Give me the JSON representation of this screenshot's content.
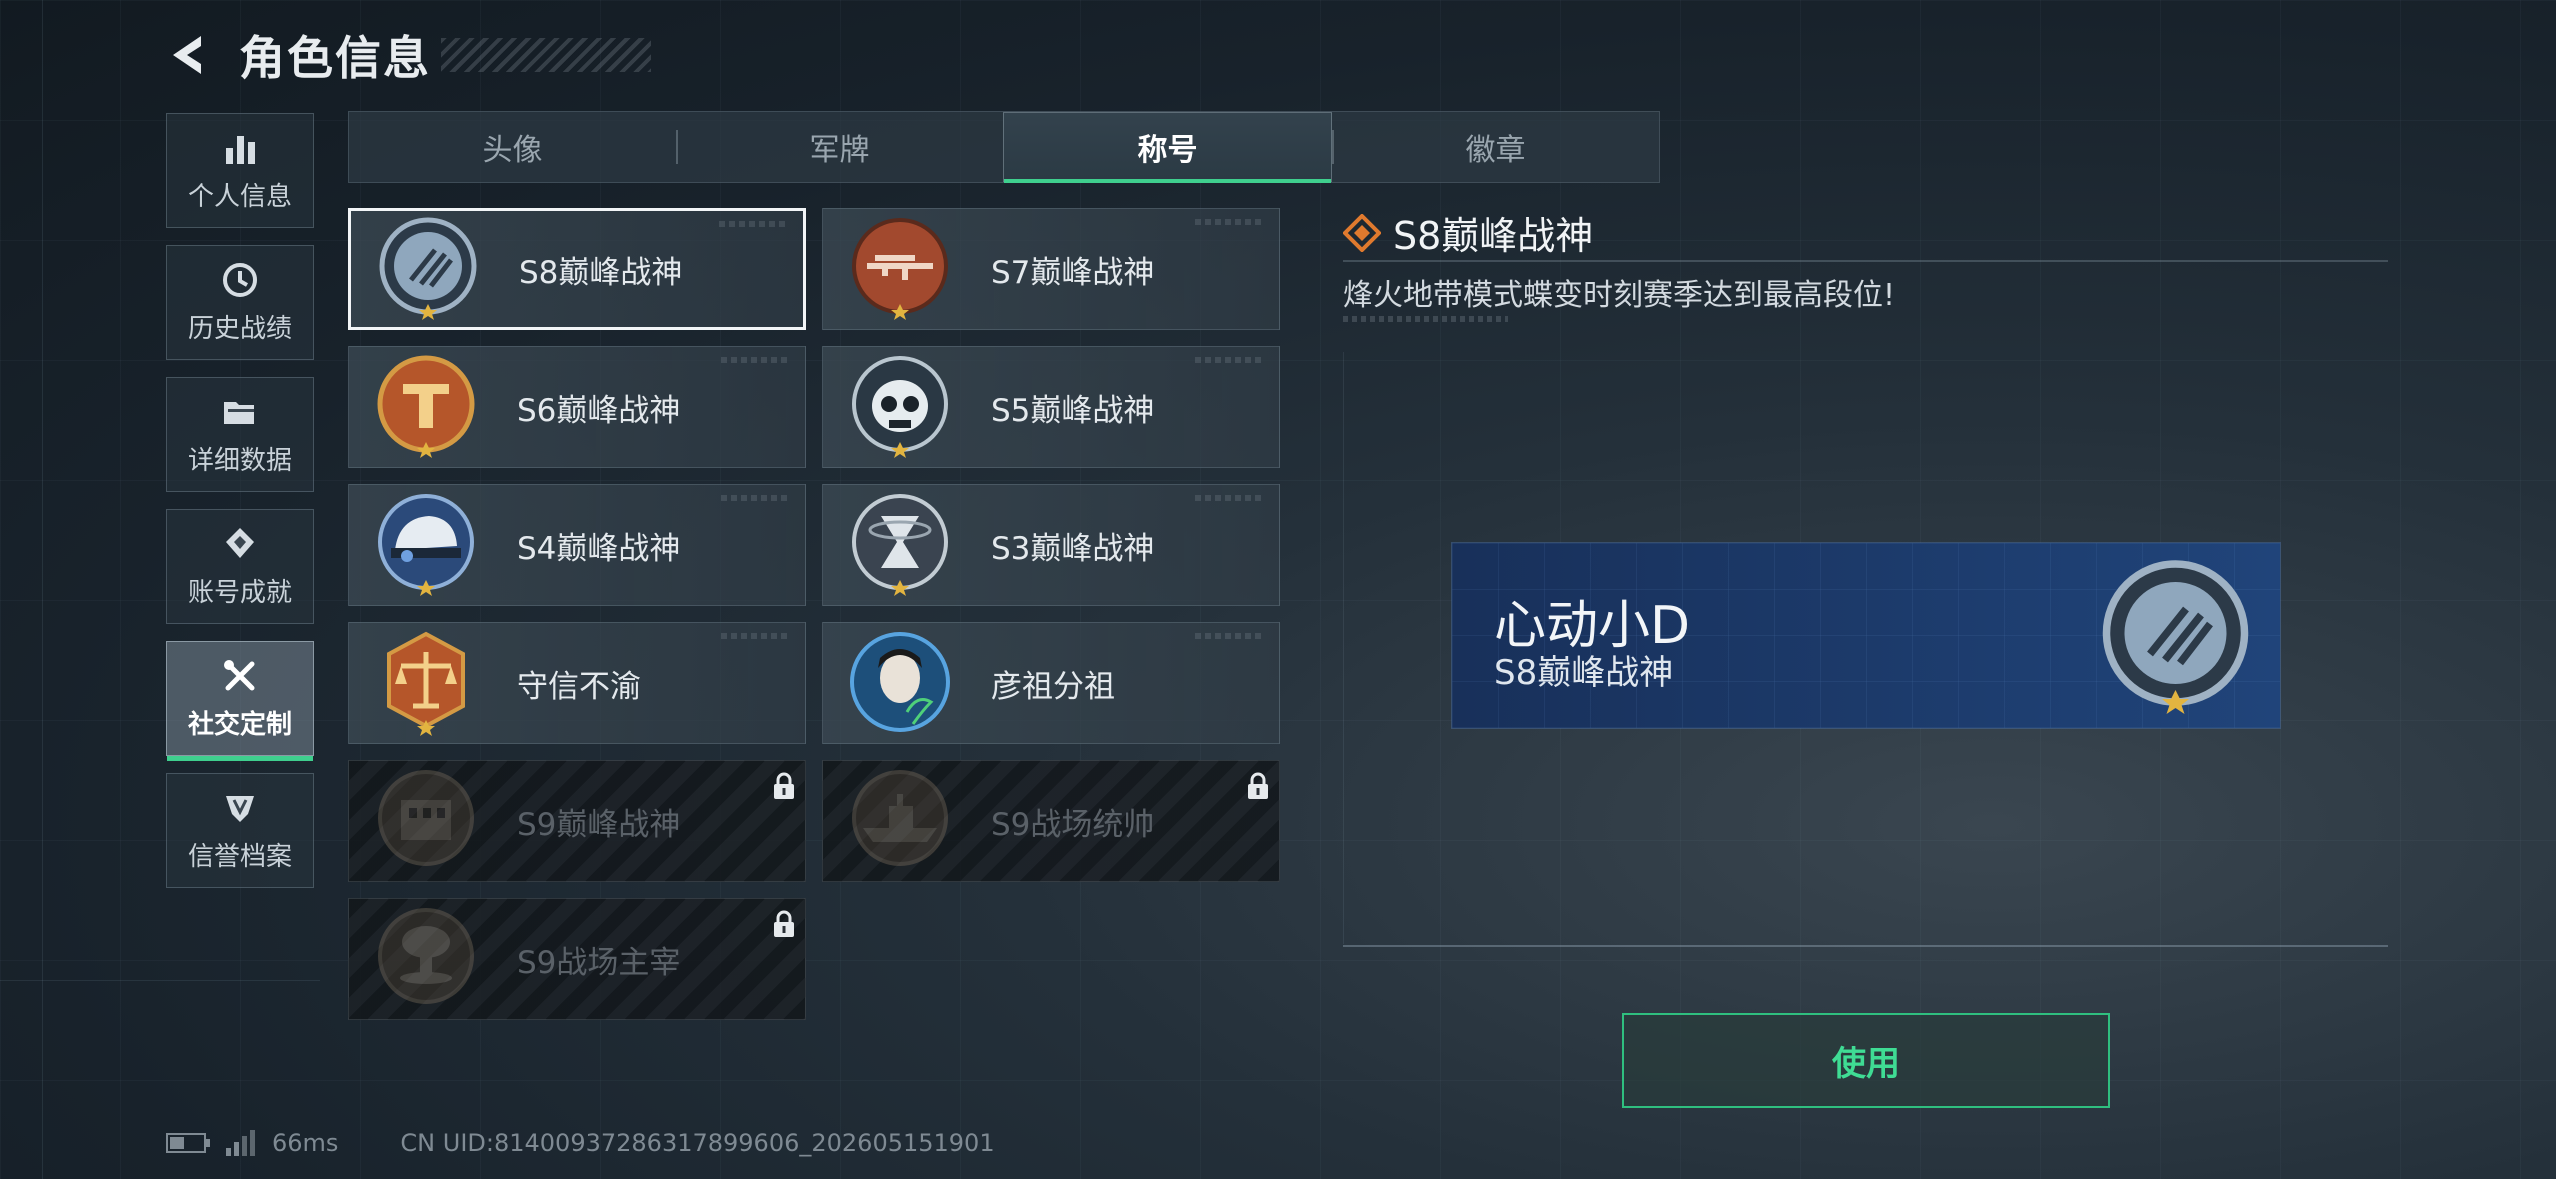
{
  "header": {
    "title": "角色信息"
  },
  "nav": {
    "items": [
      {
        "label": "个人信息",
        "icon": "bar-chart-icon",
        "active": false
      },
      {
        "label": "历史战绩",
        "icon": "clock-icon",
        "active": false
      },
      {
        "label": "详细数据",
        "icon": "folder-icon",
        "active": false
      },
      {
        "label": "账号成就",
        "icon": "achievement-icon",
        "active": false
      },
      {
        "label": "社交定制",
        "icon": "tools-icon",
        "active": true
      },
      {
        "label": "信誉档案",
        "icon": "credit-shield-icon",
        "active": false
      }
    ]
  },
  "tabs": [
    {
      "label": "头像",
      "active": false
    },
    {
      "label": "军牌",
      "active": false
    },
    {
      "label": "称号",
      "active": true
    },
    {
      "label": "徽章",
      "active": false
    }
  ],
  "titles": [
    {
      "label": "S8巅峰战神",
      "icon": "s8-emblem-icon",
      "selected": true,
      "locked": false,
      "color": "#8fa7bd"
    },
    {
      "label": "S7巅峰战神",
      "icon": "s7-rifle-emblem-icon",
      "selected": false,
      "locked": false,
      "color": "#a2492e"
    },
    {
      "label": "S6巅峰战神",
      "icon": "s6-emblem-icon",
      "selected": false,
      "locked": false,
      "color": "#b5562a"
    },
    {
      "label": "S5巅峰战神",
      "icon": "s5-skull-emblem-icon",
      "selected": false,
      "locked": false,
      "color": "#2a3844"
    },
    {
      "label": "S4巅峰战神",
      "icon": "s4-helmet-emblem-icon",
      "selected": false,
      "locked": false,
      "color": "#2b4a7a"
    },
    {
      "label": "S3巅峰战神",
      "icon": "s3-hourglass-emblem-icon",
      "selected": false,
      "locked": false,
      "color": "#3a4450"
    },
    {
      "label": "守信不渝",
      "icon": "scales-emblem-icon",
      "selected": false,
      "locked": false,
      "color": "#b5562a"
    },
    {
      "label": "彦祖分祖",
      "icon": "portrait-emblem-icon",
      "selected": false,
      "locked": false,
      "color": "#1d4f7a"
    },
    {
      "label": "S9巅峰战神",
      "icon": "s9-building-emblem-icon",
      "selected": false,
      "locked": true,
      "color": "#5a4a3a"
    },
    {
      "label": "S9战场统帅",
      "icon": "s9-warship-emblem-icon",
      "selected": false,
      "locked": true,
      "color": "#5a4a3a"
    },
    {
      "label": "S9战场主宰",
      "icon": "s9-explosion-emblem-icon",
      "selected": false,
      "locked": true,
      "color": "#5a4a3a"
    }
  ],
  "detail": {
    "title": "S8巅峰战神",
    "description": "烽火地带模式蝶变时刻赛季达到最高段位!"
  },
  "preview": {
    "player_name": "心动小D",
    "title": "S8巅峰战神"
  },
  "use_button": {
    "label": "使用"
  },
  "status": {
    "latency": "66ms",
    "uid": "CN UID:8140093728631789960​6_202605151901"
  },
  "colors": {
    "accent": "#3fcf8e",
    "title_diamond": "#e07a2e"
  }
}
